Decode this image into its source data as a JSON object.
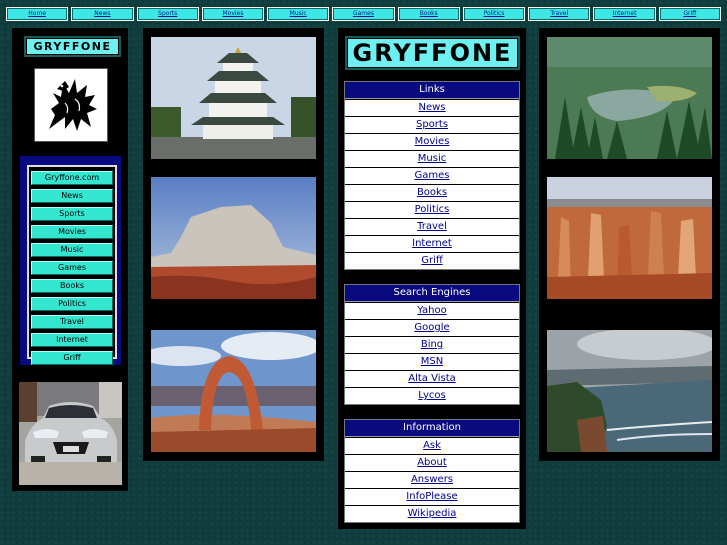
{
  "topnav": [
    "Home",
    "News",
    "Sports",
    "Movies",
    "Music",
    "Games",
    "Books",
    "Politics",
    "Travel",
    "Internet",
    "Griff"
  ],
  "left": {
    "logo": "GRYFFONE",
    "menu": [
      "Gryffone.com",
      "News",
      "Sports",
      "Movies",
      "Music",
      "Games",
      "Books",
      "Politics",
      "Travel",
      "Internet",
      "Griff"
    ]
  },
  "center": {
    "logo": "GRYFFONE",
    "links": {
      "header": "Links",
      "items": [
        "News",
        "Sports",
        "Movies",
        "Music",
        "Games",
        "Books",
        "Politics",
        "Travel",
        "Internet",
        "Griff"
      ]
    },
    "search": {
      "header": "Search Engines",
      "items": [
        "Yahoo",
        "Google",
        "Bing",
        "MSN",
        "Alta Vista",
        "Lycos"
      ]
    },
    "info": {
      "header": "Information",
      "items": [
        "Ask",
        "About",
        "Answers",
        "InfoPlease",
        "Wikipedia"
      ]
    }
  },
  "photos": [
    "japanese-castle",
    "desert-mesa",
    "delicate-arch",
    "forest-lake",
    "red-hoodoos",
    "coastal-cliffs"
  ]
}
